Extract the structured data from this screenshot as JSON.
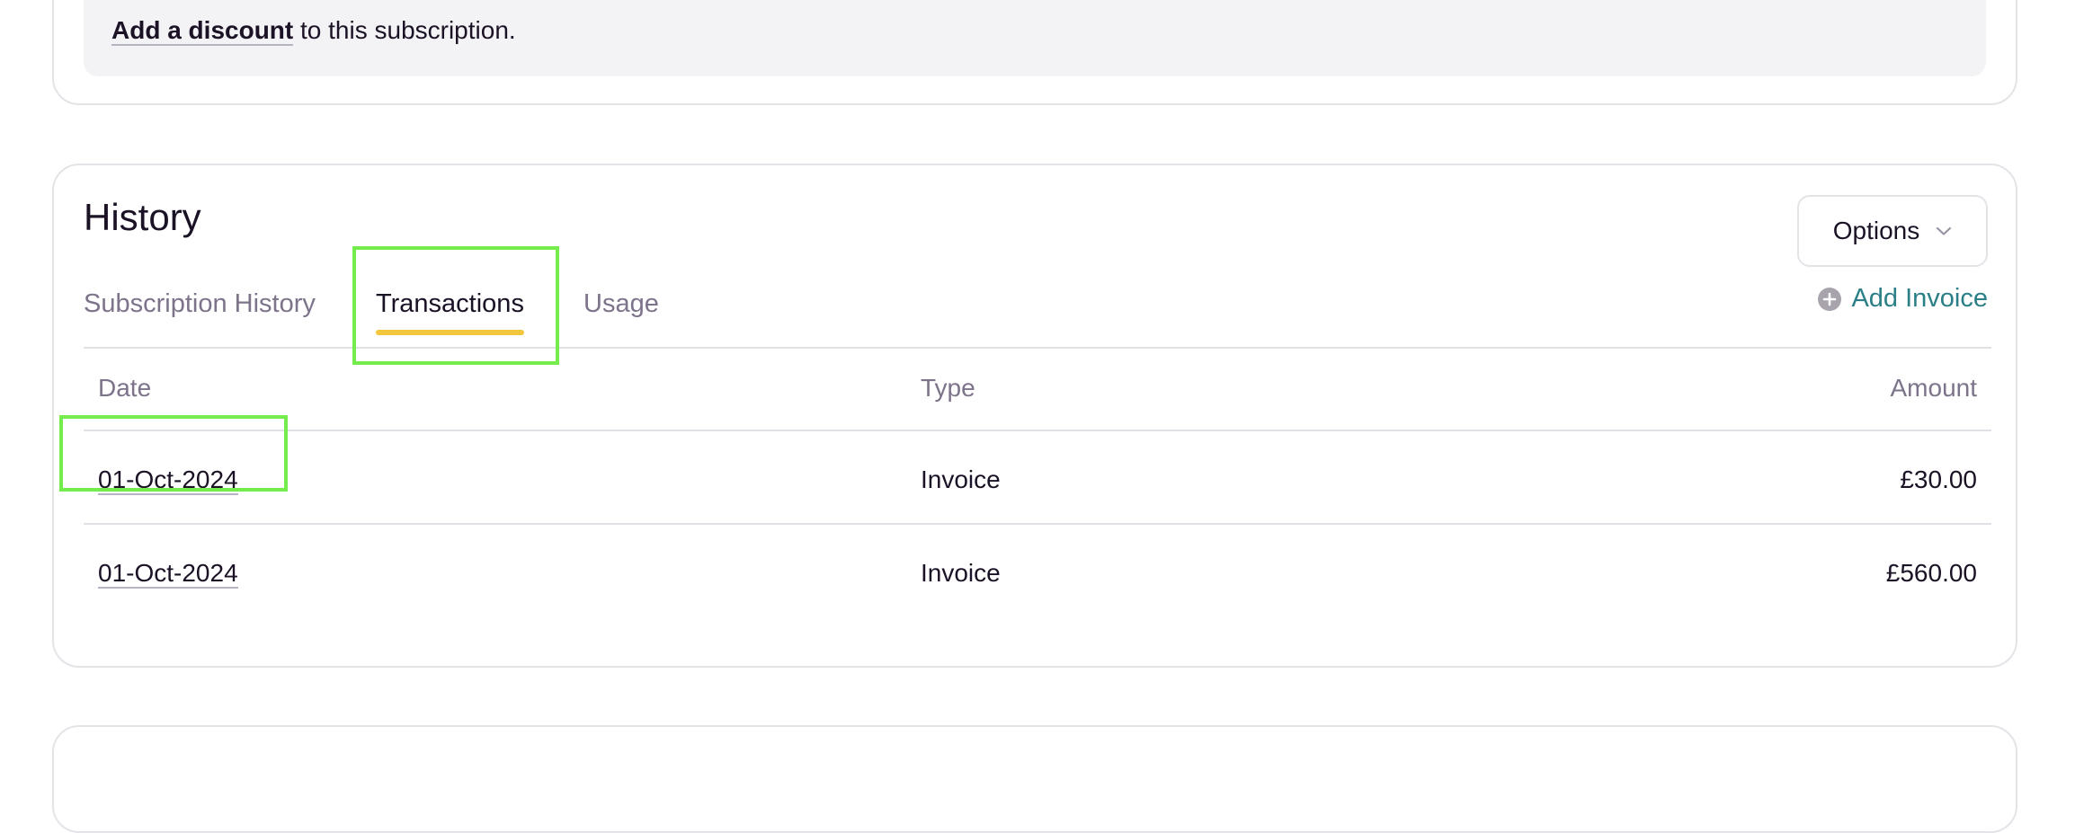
{
  "discount": {
    "link_label": "Add a discount",
    "rest_text": " to this subscription."
  },
  "history": {
    "title": "History",
    "options_label": "Options",
    "add_invoice_label": "Add Invoice",
    "tabs": [
      {
        "label": "Subscription History",
        "active": false
      },
      {
        "label": "Transactions",
        "active": true
      },
      {
        "label": "Usage",
        "active": false
      }
    ],
    "table": {
      "headers": {
        "date": "Date",
        "type": "Type",
        "amount": "Amount"
      },
      "rows": [
        {
          "date": "01-Oct-2024",
          "type": "Invoice",
          "amount": "£30.00"
        },
        {
          "date": "01-Oct-2024",
          "type": "Invoice",
          "amount": "£560.00"
        }
      ]
    }
  },
  "colors": {
    "accent_tab_underline": "#f2c73e",
    "link_teal": "#2b7f86",
    "highlight_green": "#74ec4c"
  }
}
